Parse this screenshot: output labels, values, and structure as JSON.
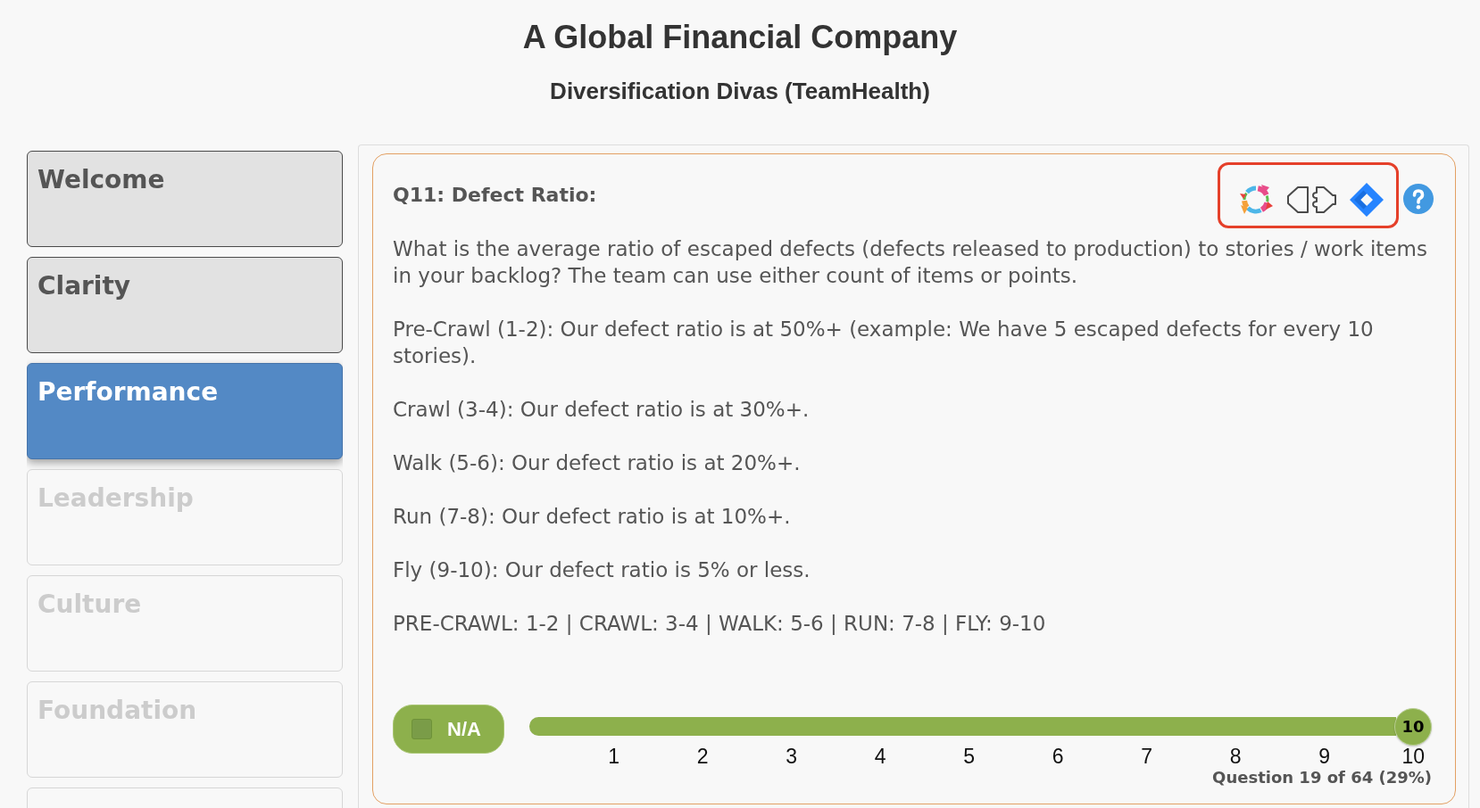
{
  "header": {
    "title": "A Global Financial Company",
    "subtitle": "Diversification Divas (TeamHealth)"
  },
  "sidebar": {
    "items": [
      {
        "label": "Welcome",
        "selected": false,
        "disabled": false
      },
      {
        "label": "Clarity",
        "selected": false,
        "disabled": false
      },
      {
        "label": "Performance",
        "selected": true,
        "disabled": false
      },
      {
        "label": "Leadership",
        "selected": false,
        "disabled": true
      },
      {
        "label": "Culture",
        "selected": false,
        "disabled": true
      },
      {
        "label": "Foundation",
        "selected": false,
        "disabled": true
      },
      {
        "selected": false,
        "disabled": true
      }
    ]
  },
  "question": {
    "title": "Q11: Defect Ratio:",
    "highlighted": true,
    "integrations": [
      {
        "kind": "ring"
      },
      {
        "kind": "plug"
      },
      {
        "kind": "diamond"
      }
    ],
    "paragraphs": [
      "What is the average ratio of escaped defects (defects released to production) to stories / work items in your backlog? The team can use either count of items or points.",
      "Pre-Crawl (1-2): Our defect ratio is at 50%+ (example: We have 5 escaped defects for every 10 stories).",
      "Crawl (3-4): Our defect ratio is at 30%+.",
      "Walk (5-6): Our defect ratio is at 20%+.",
      "Run (7-8): Our defect ratio is at 10%+.",
      "Fly (9-10): Our defect ratio is 5% or less.",
      "PRE-CRAWL: 1-2 | CRAWL: 3-4 | WALK: 5-6 | RUN: 7-8 | FLY: 9-10"
    ],
    "na_option": {
      "label": "N/A",
      "checked": false
    },
    "slider": {
      "level": 1,
      "value_label": "10",
      "ticks": [
        "1",
        "2",
        "3",
        "4",
        "5",
        "6",
        "7",
        "8",
        "9",
        "10"
      ]
    },
    "progress": "Question 19 of 64 (29%)"
  }
}
